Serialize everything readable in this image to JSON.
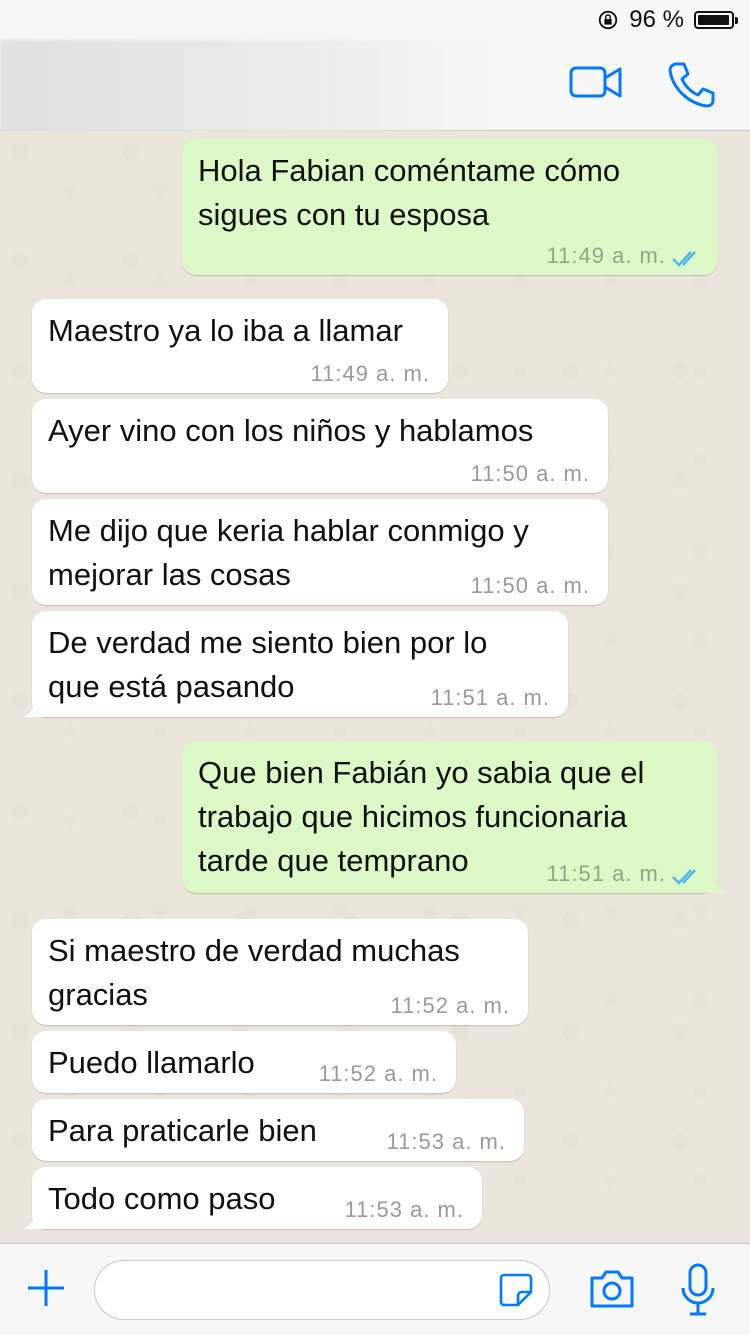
{
  "status_bar": {
    "battery_percent": "96 %",
    "battery_level": 0.96
  },
  "header": {
    "contact_name": "",
    "video_icon": "video-camera-icon",
    "call_icon": "phone-icon"
  },
  "messages": [
    {
      "direction": "outgoing",
      "lines": [
        "Hola Fabian coméntame cómo",
        "sigues con tu esposa"
      ],
      "time": "11:49 a. m.",
      "read": true
    },
    {
      "direction": "incoming",
      "lines": [
        "Maestro ya lo iba a llamar"
      ],
      "time": "11:49 a. m."
    },
    {
      "direction": "incoming",
      "lines": [
        "Ayer vino con los niños y hablamos"
      ],
      "time": "11:50 a. m."
    },
    {
      "direction": "incoming",
      "lines": [
        "Me dijo que keria hablar conmigo y",
        "mejorar las cosas"
      ],
      "time": "11:50 a. m."
    },
    {
      "direction": "incoming",
      "lines": [
        "De verdad me siento bien por lo",
        "que está pasando"
      ],
      "time": "11:51 a. m."
    },
    {
      "direction": "outgoing",
      "lines": [
        "Que bien Fabián yo sabia que el",
        "trabajo que hicimos funcionaria",
        "tarde que temprano"
      ],
      "time": "11:51 a. m.",
      "read": true
    },
    {
      "direction": "incoming",
      "lines": [
        "Si maestro de verdad muchas",
        "gracias"
      ],
      "time": "11:52 a. m."
    },
    {
      "direction": "incoming",
      "lines": [
        "Puedo llamarlo"
      ],
      "time": "11:52 a. m."
    },
    {
      "direction": "incoming",
      "lines": [
        "Para praticarle bien"
      ],
      "time": "11:53 a. m."
    },
    {
      "direction": "incoming",
      "lines": [
        "Todo como paso"
      ],
      "time": "11:53 a. m."
    }
  ],
  "input_bar": {
    "placeholder": "",
    "icons": [
      "plus-icon",
      "sticker-icon",
      "camera-icon",
      "microphone-icon"
    ]
  },
  "colors": {
    "accent": "#007aff",
    "outgoing_bubble": "#dcf8c6",
    "incoming_bubble": "#ffffff",
    "read_ticks": "#4fb6ec"
  }
}
